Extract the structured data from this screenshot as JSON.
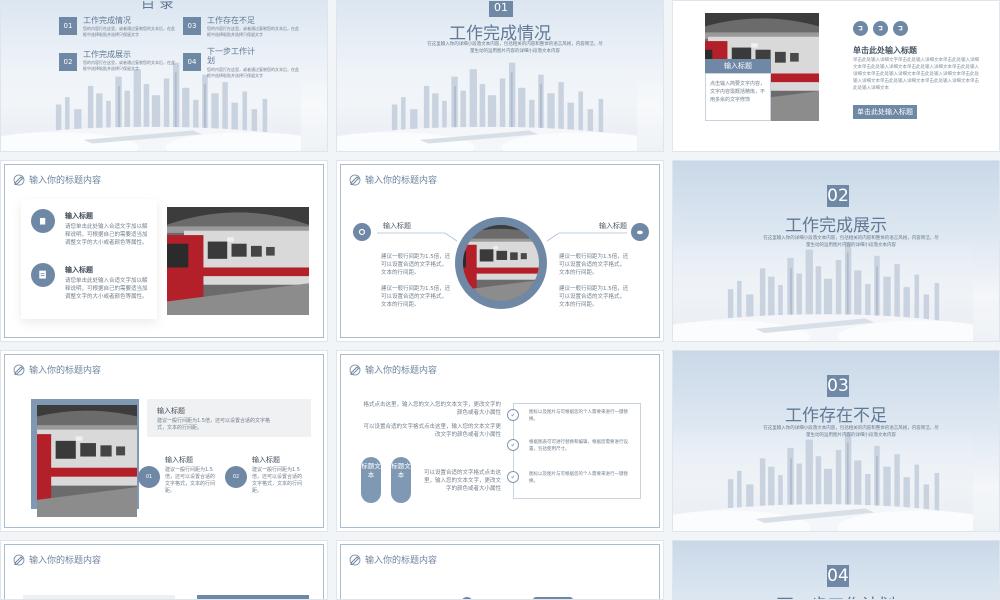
{
  "slide1": {
    "title_partial": "目 录",
    "items": [
      {
        "num": "01",
        "title": "工作完成情况",
        "desc": "您的内容打在这里，或者通过复制您的文本后，在此框中选择粘贴并选择只保留文字"
      },
      {
        "num": "02",
        "title": "工作完成展示",
        "desc": "您的内容打在这里，或者通过复制您的文本后，在此框中选择粘贴并选择只保留文字"
      },
      {
        "num": "03",
        "title": "工作存在不足",
        "desc": "您的内容打在这里，或者通过复制您的文本后，在此框中选择粘贴并选择只保留文字"
      },
      {
        "num": "04",
        "title": "下一步工作计划",
        "desc": "您的内容打在这里，或者通过复制您的文本后，在此框中选择粘贴并选择只保留文字"
      }
    ]
  },
  "slide2": {
    "num": "01",
    "title": "工作完成情况",
    "desc": "在这里输入你的详细小段落文本内容，包括相关的内容和整体的语言风格，内容简洁，尽量生动的运用图片内容的详细小段落文本内容"
  },
  "slide3": {
    "photo_label": "输入标题",
    "photo_desc": "点击输入简要文字内容，文字内容需概括精炼，不用多余的文字修饰",
    "title": "单击此处输入标题",
    "desc": "单击此处输入详细文字单击此处输入详细文本单击此处输入详细文本单击此处输入详细文本单击此处输入详细文本单击此处输入详细文本单击此处输入详细文本单击此处输入详细文本单击此处输入详细文本单击此处输入详细文本单击此处输入详细文本单击此处输入详细文本",
    "button": "单击此处输入标题"
  },
  "header_title": "输入你的标题内容",
  "slide4": {
    "items": [
      {
        "label": "输入标题",
        "desc": "请您单击此处输入合适文字加以解释说明，可根据自己的需要适当加调整文字的大小或者颜色等属性。"
      },
      {
        "label": "输入标题",
        "desc": "请您单击此处输入合适文字加以解释说明，可根据自己的需要适当加调整文字的大小或者颜色等属性。"
      }
    ]
  },
  "slide5": {
    "left_label": "输入标题",
    "right_label": "输入标题",
    "left_texts": [
      "建议一般行间距为1.5倍，还可以设置合适的文字格式，文本的行间距。",
      "建议一般行间距为1.5倍，还可以设置合适的文字格式，文本的行间距。"
    ],
    "right_texts": [
      "建议一般行间距为1.5倍，还可以设置合适的文字格式，文本的行间距。",
      "建议一般行间距为1.5倍，还可以设置合适的文字格式，文本的行间距。"
    ]
  },
  "slide6": {
    "num": "02",
    "title": "工作完成展示",
    "desc": "在这里输入你的详细小段落文本内容，包括相关的内容和整体的语言风格，内容简洁，尽量生动的运用图片内容的详细小段落文本内容"
  },
  "slide7": {
    "top_label": "输入标题",
    "top_desc": "建议一般行间距为1.5倍，还可以设置合适的文字格式，文本的行间距。",
    "items": [
      {
        "num": "01",
        "label": "输入标题",
        "desc": "建议一般行间距为1.5倍，还可以设置合适的文字格式，文本的行间距。"
      },
      {
        "num": "02",
        "label": "输入标题",
        "desc": "建议一般行间距为1.5倍，还可以设置合适的文字格式，文本的行间距。"
      }
    ]
  },
  "slide8": {
    "para1": "格式点击这里，输入您的文入您的文本文字，更改文字的颜色或者大小属性",
    "para2": "可以设置合适的文字格式点击这里，输入您的文本文字更改文字的颜色或者大小属性",
    "para3": "可以设置合适的文字格式点击这里，输入您的文本文字，更改文字的颜色或者大小属性",
    "pill1": "标题文本",
    "pill2": "标题文本",
    "checks": [
      "图标以及图片与可根据您的个人需要来进行一键替换。",
      "根据图表可可进行替换和编辑，根据您需要进行设置，包括使用尺寸。",
      "图标以及图片与可根据您的个人需要来进行一键替换。"
    ]
  },
  "slide9": {
    "num": "03",
    "title": "工作存在不足",
    "desc": "在这里输入你的详细小段落文本内容，包括相关的内容和整体的语言风格，内容简洁，尽量生动的运用图片内容的详细小段落文本内容"
  },
  "slide12": {
    "num": "04",
    "title": "下一步工作计划"
  },
  "colors": {
    "accent": "#6f88a6",
    "text": "#5f7996",
    "frame": "#a9bdd1"
  }
}
